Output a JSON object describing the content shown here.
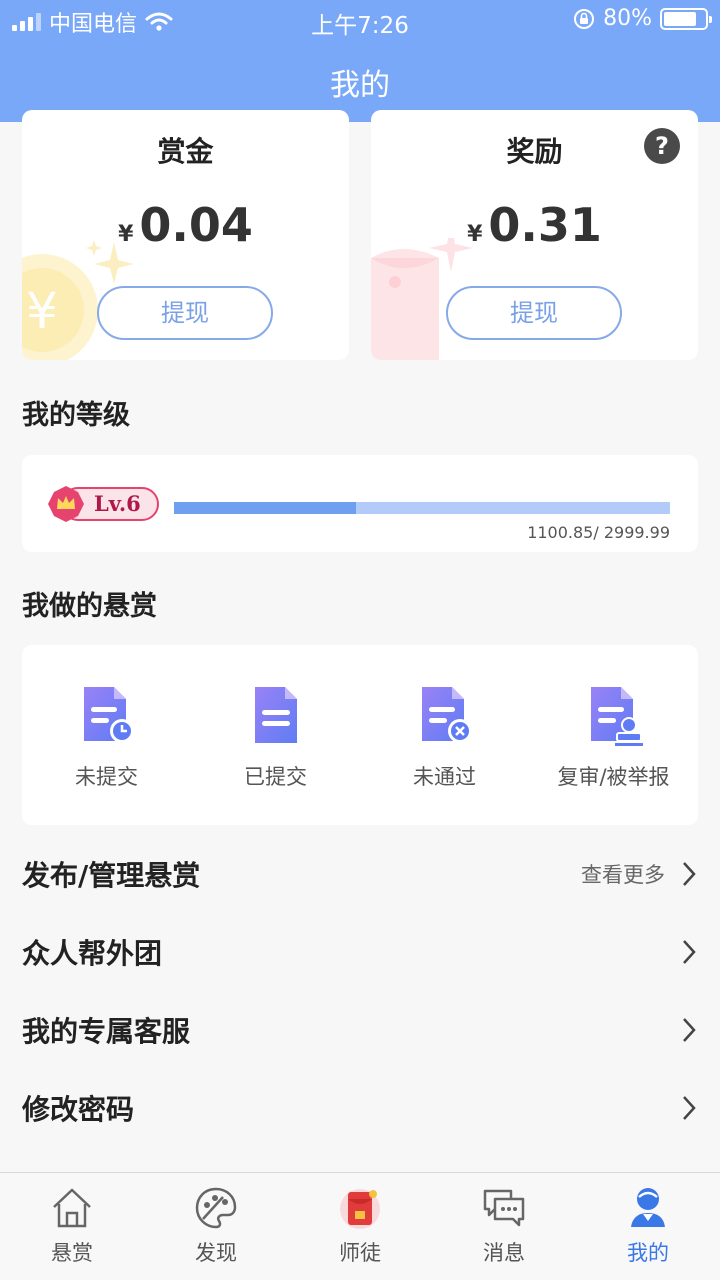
{
  "status_bar": {
    "carrier": "中国电信",
    "time": "上午7:26",
    "battery": "80%",
    "battery_level": 0.8
  },
  "header": {
    "title": "我的"
  },
  "bounty_card": {
    "title": "赏金",
    "currency": "¥",
    "amount": "0.04",
    "button": "提现"
  },
  "reward_card": {
    "title": "奖励",
    "currency": "¥",
    "amount": "0.31",
    "button": "提现",
    "help_icon": "question-icon"
  },
  "level": {
    "section_title": "我的等级",
    "badge": "Lv.6",
    "progress_text": "1100.85/ 2999.99",
    "current": 1100.85,
    "max": 2999.99
  },
  "my_bounties": {
    "section_title": "我做的悬赏",
    "items": [
      {
        "label": "未提交",
        "icon": "doc-clock-icon"
      },
      {
        "label": "已提交",
        "icon": "doc-icon"
      },
      {
        "label": "未通过",
        "icon": "doc-rejected-icon"
      },
      {
        "label": "复审/被举报",
        "icon": "doc-stamp-icon"
      }
    ]
  },
  "menu": {
    "publish": {
      "label": "发布/管理悬赏",
      "more": "查看更多"
    },
    "group": {
      "label": "众人帮外团"
    },
    "service": {
      "label": "我的专属客服"
    },
    "password": {
      "label": "修改密码"
    }
  },
  "tabs": [
    {
      "label": "悬赏",
      "icon": "home-icon"
    },
    {
      "label": "发现",
      "icon": "palette-icon"
    },
    {
      "label": "师徒",
      "icon": "red-envelope-icon"
    },
    {
      "label": "消息",
      "icon": "chat-icon"
    },
    {
      "label": "我的",
      "icon": "profile-icon",
      "active": true
    }
  ],
  "colors": {
    "header": "#7aa8f8",
    "accent": "#3b78e7",
    "button_border": "#86a9e8",
    "level_badge": "#e6436f",
    "progress": "#6f9ff0"
  }
}
